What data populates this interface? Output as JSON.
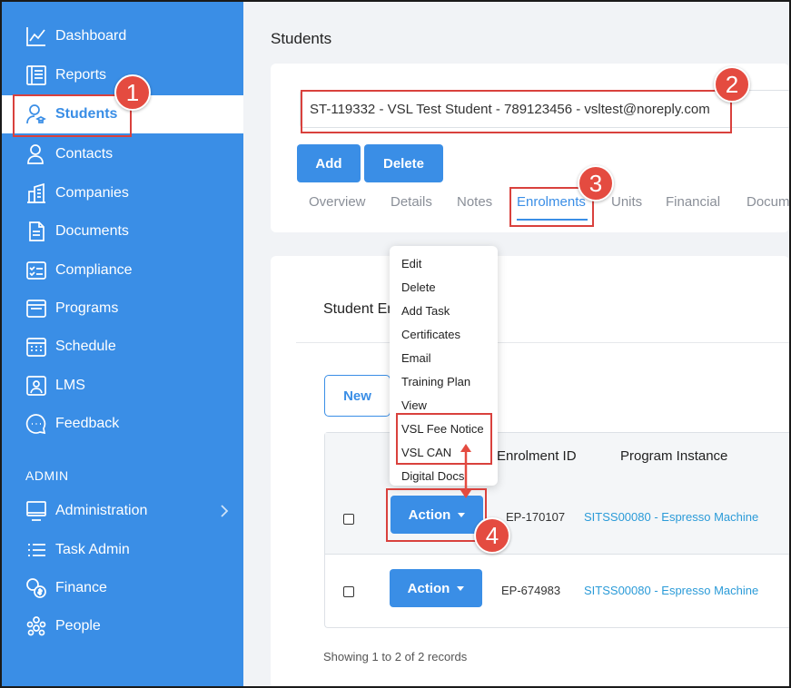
{
  "sidebar": {
    "items": [
      {
        "label": "Dashboard",
        "icon": "chart-line-icon"
      },
      {
        "label": "Reports",
        "icon": "report-icon"
      },
      {
        "label": "Students",
        "icon": "student-icon",
        "active": true
      },
      {
        "label": "Contacts",
        "icon": "contacts-icon"
      },
      {
        "label": "Companies",
        "icon": "building-icon"
      },
      {
        "label": "Documents",
        "icon": "document-icon"
      },
      {
        "label": "Compliance",
        "icon": "checklist-icon"
      },
      {
        "label": "Programs",
        "icon": "window-icon"
      },
      {
        "label": "Schedule",
        "icon": "calendar-icon"
      },
      {
        "label": "LMS",
        "icon": "lms-icon"
      },
      {
        "label": "Feedback",
        "icon": "chat-icon"
      }
    ],
    "admin_label": "ADMIN",
    "admin_items": [
      {
        "label": "Administration",
        "icon": "monitor-icon"
      },
      {
        "label": "Task Admin",
        "icon": "list-icon"
      },
      {
        "label": "Finance",
        "icon": "coins-icon"
      },
      {
        "label": "People",
        "icon": "people-icon"
      }
    ]
  },
  "page": {
    "title": "Students",
    "student_value": "ST-119332 - VSL Test Student - 789123456 - vsltest@noreply.com",
    "add_label": "Add",
    "delete_label": "Delete",
    "tabs": [
      "Overview",
      "Details",
      "Notes",
      "Enrolments",
      "Units",
      "Financial",
      "Documents"
    ],
    "active_tab": "Enrolments"
  },
  "enrolments": {
    "title": "Student Enrolments",
    "new_label": "New",
    "columns": [
      "Enrolment ID",
      "Program Instance"
    ],
    "rows": [
      {
        "action": "Action",
        "id": "EP-170107",
        "program": "SITSS00080 - Espresso Machine"
      },
      {
        "action": "Action",
        "id": "EP-674983",
        "program": "SITSS00080 - Espresso Machine"
      }
    ],
    "footer": "Showing 1 to 2 of 2 records"
  },
  "dropdown": {
    "items": [
      "Edit",
      "Delete",
      "Add Task",
      "Certificates",
      "Email",
      "Training Plan",
      "View",
      "VSL Fee Notice",
      "VSL CAN",
      "Digital Docs"
    ]
  },
  "annotations": {
    "badges": [
      "1",
      "2",
      "3",
      "4"
    ],
    "color": "#d9413d"
  },
  "colors": {
    "primary": "#3a8ee6",
    "link": "#2b9bd8",
    "annotation": "#e44b40"
  }
}
